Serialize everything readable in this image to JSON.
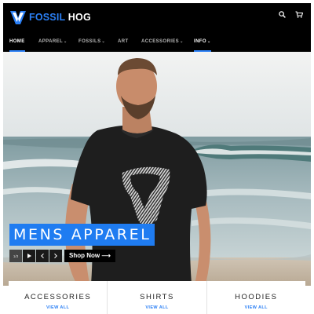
{
  "brand": {
    "name_part1": "FOSSIL",
    "name_part2": " HOG",
    "accent_color": "#2a7ff5"
  },
  "header": {
    "icons": [
      "search-icon",
      "cart-icon"
    ]
  },
  "nav": {
    "items": [
      {
        "label": "HOME",
        "dropdown": false,
        "active": true
      },
      {
        "label": "APPAREL",
        "dropdown": true,
        "active": false
      },
      {
        "label": "FOSSILS",
        "dropdown": true,
        "active": false
      },
      {
        "label": "ART",
        "dropdown": false,
        "active": false
      },
      {
        "label": "ACCESSORIES",
        "dropdown": true,
        "active": false
      },
      {
        "label": "INFO",
        "dropdown": true,
        "active": false
      }
    ],
    "underline_color": "#2a7ff5"
  },
  "hero": {
    "headline": "MENS APPAREL",
    "headline_bg": "#1f7cf1",
    "counter": "1/3",
    "play_icon": "play-icon",
    "prev_icon": "chevron-left-icon",
    "next_icon": "chevron-right-icon",
    "cta": "Shop Now ⟶"
  },
  "categories": [
    {
      "title": "ACCESSORIES",
      "link": "VIEW ALL"
    },
    {
      "title": "SHIRTS",
      "link": "VIEW ALL"
    },
    {
      "title": "HOODIES",
      "link": "VIEW ALL"
    }
  ]
}
